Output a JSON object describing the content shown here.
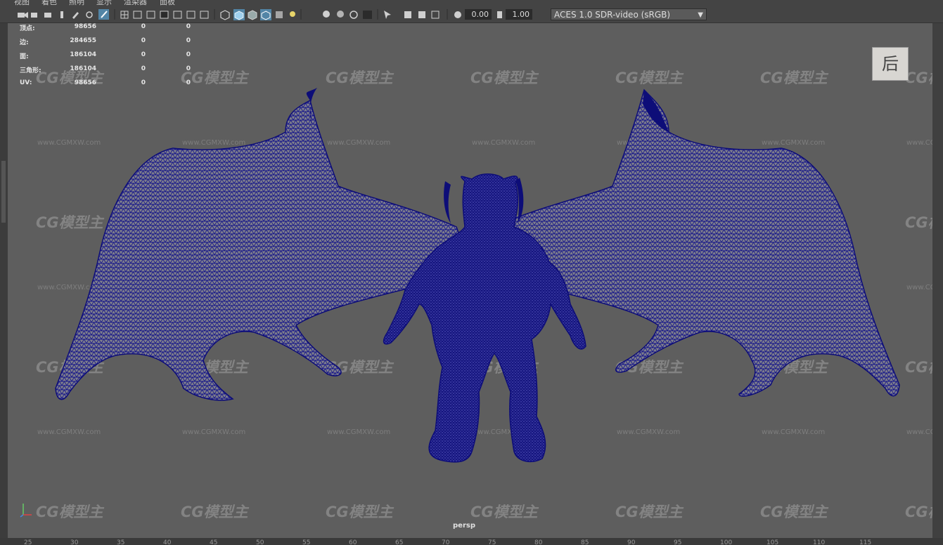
{
  "menu": {
    "items": [
      "视图",
      "着色",
      "照明",
      "显示",
      "渲染器",
      "面板"
    ]
  },
  "toolbar": {
    "exposure_value": "0.00",
    "gamma_value": "1.00",
    "color_space": "ACES 1.0 SDR-video (sRGB)"
  },
  "hud": {
    "rows": [
      {
        "label": "顶点:",
        "total": "98656",
        "selected": "0",
        "selected2": "0"
      },
      {
        "label": "边:",
        "total": "284655",
        "selected": "0",
        "selected2": "0"
      },
      {
        "label": "面:",
        "total": "186104",
        "selected": "0",
        "selected2": "0"
      },
      {
        "label": "三角形:",
        "total": "186104",
        "selected": "0",
        "selected2": "0"
      },
      {
        "label": "UV:",
        "total": "98656",
        "selected": "0",
        "selected2": "0"
      }
    ]
  },
  "view_cube": {
    "label": "后"
  },
  "camera": {
    "name": "persp"
  },
  "watermark": {
    "logo": "CG模型主",
    "url": "www.CGMXW.com"
  },
  "ruler": {
    "ticks": [
      "25",
      "30",
      "35",
      "40",
      "45",
      "50",
      "55",
      "60",
      "65",
      "70",
      "75",
      "80",
      "85",
      "90",
      "95",
      "100",
      "105",
      "110",
      "115"
    ]
  },
  "colors": {
    "wireframe": "#0d0d78",
    "viewport_bg": "#5e5e5e",
    "highlight": "#5285a6"
  }
}
